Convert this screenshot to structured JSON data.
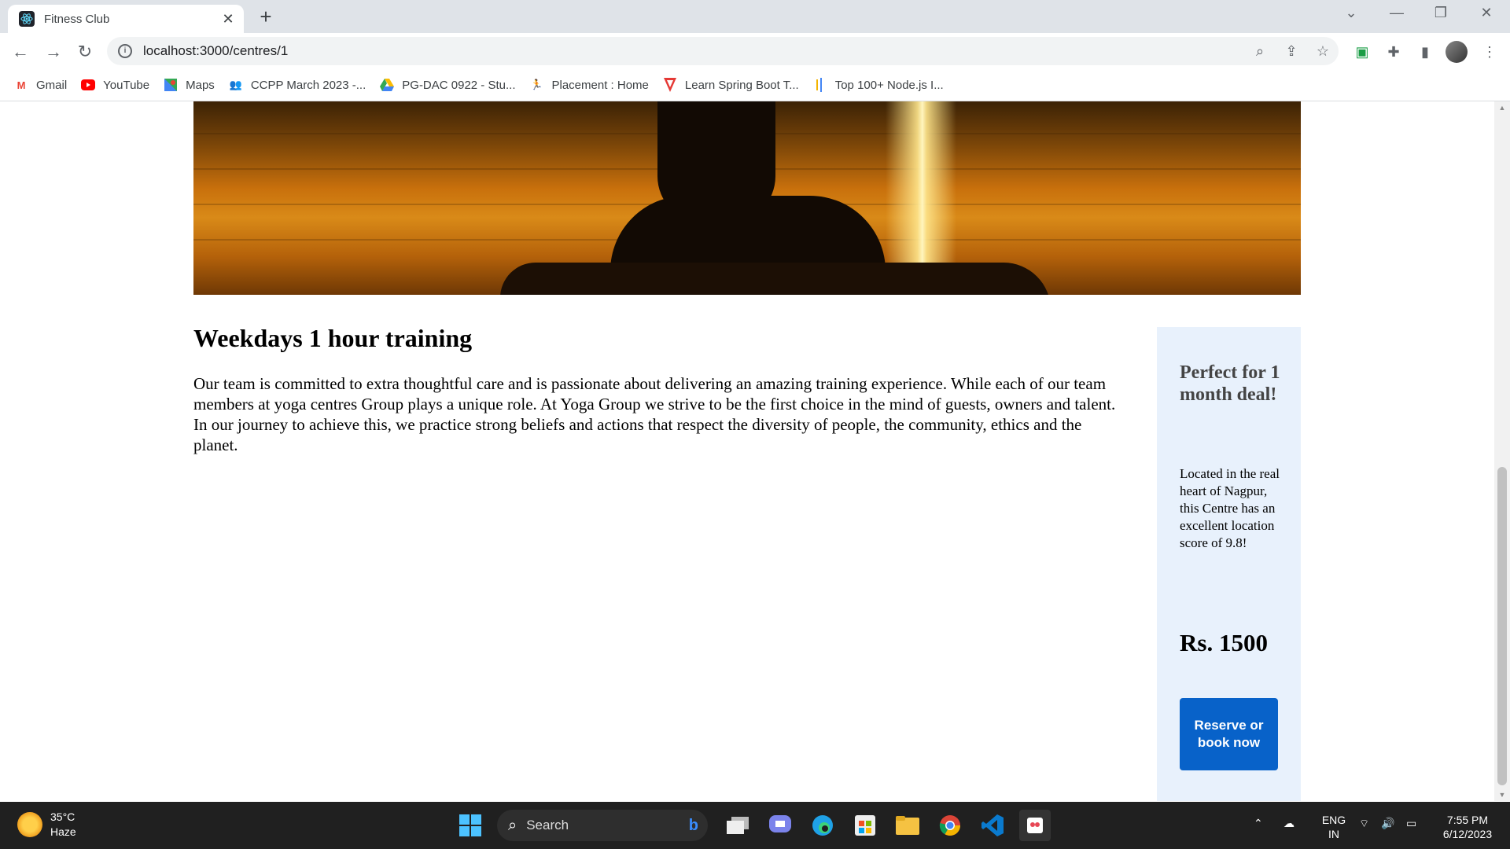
{
  "browser": {
    "tab_title": "Fitness Club",
    "url": "localhost:3000/centres/1",
    "bookmarks": [
      {
        "label": "Gmail",
        "icon": "gmail-icon",
        "color": "#EA4335"
      },
      {
        "label": "YouTube",
        "icon": "youtube-icon",
        "color": "#FF0000"
      },
      {
        "label": "Maps",
        "icon": "maps-icon",
        "color": "#34A853"
      },
      {
        "label": "CCPP March 2023 -...",
        "icon": "people-icon",
        "color": "#4285F4"
      },
      {
        "label": "PG-DAC 0922 - Stu...",
        "icon": "drive-icon",
        "color": "#FBBC04"
      },
      {
        "label": "Placement : Home",
        "icon": "runner-icon",
        "color": "#C62828"
      },
      {
        "label": "Learn Spring Boot T...",
        "icon": "tutorial-icon",
        "color": "#E53935"
      },
      {
        "label": "Top 100+ Node.js I...",
        "icon": "bars-icon",
        "color": "#F4B400"
      }
    ]
  },
  "page": {
    "section_title": "Weekdays 1 hour training",
    "description": "Our team is committed to extra thoughtful care and is passionate about delivering an amazing training experience. While each of our team members at yoga centres Group plays a unique role. At Yoga Group we strive to be the first choice in the mind of guests, owners and talent. In our journey to achieve this, we practice strong beliefs and actions that respect the diversity of people, the community, ethics and the planet.",
    "deal": {
      "title": "Perfect for 1 month deal!",
      "description": "Located in the real heart of Nagpur, this Centre has an excellent location score of 9.8!",
      "price": "Rs. 1500",
      "button_label": "Reserve or book now",
      "button_color": "#0862C9",
      "card_color": "#E8F1FC"
    }
  },
  "taskbar": {
    "temperature": "35°C",
    "weather": "Haze",
    "search_label": "Search",
    "language": "ENG",
    "region": "IN",
    "time": "7:55 PM",
    "date": "6/12/2023"
  }
}
